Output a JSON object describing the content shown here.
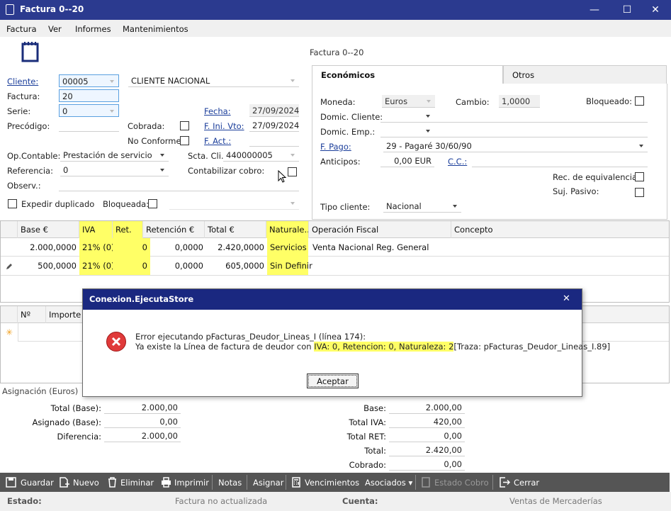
{
  "window": {
    "title": "Factura 0--20",
    "minimize": "—",
    "maximize": "☐",
    "close": "✕"
  },
  "menu": [
    "Factura",
    "Ver",
    "Informes",
    "Mantenimientos"
  ],
  "header": {
    "caption": "Factura 0--20"
  },
  "form": {
    "cliente_label": "Cliente:",
    "cliente_code": "00005",
    "cliente_name": "CLIENTE NACIONAL",
    "factura_label": "Factura:",
    "factura_value": "20",
    "serie_label": "Serie:",
    "serie_value": "0",
    "precodigo_label": "Precódigo:",
    "cobrada_label": "Cobrada:",
    "noconforme_label": "No Conforme:",
    "fecha_label": "Fecha:",
    "fecha_value": "27/09/2024",
    "finivto_label": "F. Ini. Vto:",
    "finivto_value": "27/09/2024",
    "fact_label": "F. Act.:",
    "opcontable_label": "Op.Contable:",
    "opcontable_value": "Prestación de servicio",
    "sctacli_label": "Scta. Cli.",
    "sctacli_value": "440000005",
    "referencia_label": "Referencia:",
    "referencia_value": "0",
    "contabilizar_label": "Contabilizar cobro:",
    "observ_label": "Observ.:",
    "expedir_label": "Expedir duplicado",
    "bloqueada_label": "Bloqueada:"
  },
  "tabs": [
    {
      "label": "Económicos"
    },
    {
      "label": "Otros"
    }
  ],
  "economicos": {
    "moneda_label": "Moneda:",
    "moneda_value": "Euros",
    "cambio_label": "Cambio:",
    "cambio_value": "1,0000",
    "bloqueado_label": "Bloqueado:",
    "domcliente_label": "Domic. Cliente:",
    "domemp_label": "Domic. Emp.:",
    "fpago_label": "F. Pago:",
    "fpago_value": "29 - Pagaré 30/60/90",
    "anticipos_label": "Anticipos:",
    "anticipos_value": "0,00 EUR",
    "cc_label": "C.C.:",
    "receq_label": "Rec. de equivalencia:",
    "sujpasivo_label": "Suj. Pasivo:",
    "tipocliente_label": "Tipo cliente:",
    "tipocliente_value": "Nacional"
  },
  "lines": {
    "columns": [
      "Base €",
      "IVA",
      "Ret.",
      "Retención €",
      "Total €",
      "Naturale...",
      "Operación Fiscal",
      "Concepto"
    ],
    "rows": [
      [
        "2.000,0000",
        "21% (0)",
        "0",
        "0,0000",
        "2.420,0000",
        "Servicios",
        "Venta Nacional Reg. General",
        ""
      ],
      [
        "500,0000",
        "21% (0)",
        "0",
        "0,0000",
        "605,0000",
        "Sin Definir",
        "",
        ""
      ]
    ]
  },
  "grid2": {
    "columns": [
      "Nº",
      "Importe €"
    ]
  },
  "dialog": {
    "title": "Conexion.EjecutaStore",
    "close": "✕",
    "line1": "Error ejecutando pFacturas_Deudor_Lineas_I (línea 174):",
    "line2a": "Ya existe la Línea de factura de deudor con ",
    "line2b": "IVA: 0, Retencion: 0, Naturaleza: 2",
    "line2c": "[Traza: pFacturas_Deudor_Lineas_I.89]",
    "ok": "Aceptar"
  },
  "asignacion": {
    "title": "Asignación (Euros)",
    "total_base_label": "Total (Base):",
    "total_base": "2.000,00",
    "asignado_label": "Asignado (Base):",
    "asignado": "0,00",
    "diferencia_label": "Diferencia:",
    "diferencia": "2.000,00"
  },
  "totales": {
    "base_label": "Base:",
    "base": "2.000,00",
    "iva_label": "Total IVA:",
    "iva": "420,00",
    "ret_label": "Total RET:",
    "ret": "0,00",
    "total_label": "Total:",
    "total": "2.420,00",
    "cobrado_label": "Cobrado:",
    "cobrado": "0,00"
  },
  "toolbar": {
    "guardar": "Guardar",
    "nuevo": "Nuevo",
    "eliminar": "Eliminar",
    "imprimir": "Imprimir",
    "notas": "Notas",
    "asignar": "Asignar",
    "vencimientos": "Vencimientos",
    "asociados": "Asociados ▾",
    "estado_cobro": "Estado Cobro",
    "cerrar": "Cerrar"
  },
  "status": {
    "estado_label": "Estado:",
    "estado_value": "Factura no actualizada",
    "cuenta_label": "Cuenta:",
    "cuenta_value": "Ventas de Mercaderías"
  }
}
